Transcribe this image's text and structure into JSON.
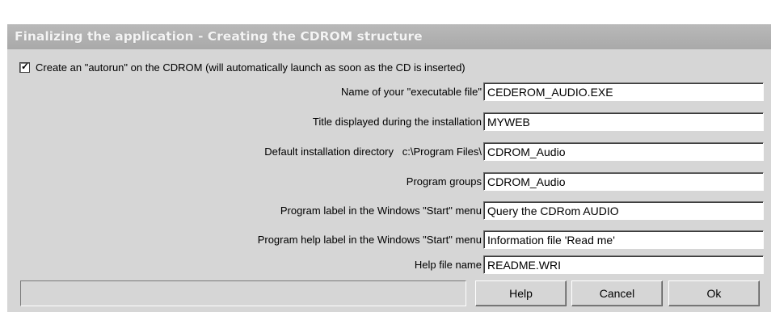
{
  "window": {
    "title": "Finalizing the application - Creating the CDROM structure"
  },
  "autorun": {
    "checked": true,
    "check_mark": "✓",
    "label": "Create an \"autorun\" on the CDROM (will automatically launch as soon as the CD is inserted)"
  },
  "fields": [
    {
      "label": "Name of your \"executable file\"",
      "value": "CEDEROM_AUDIO.EXE"
    },
    {
      "label": "Title displayed during the installation",
      "value": "MYWEB"
    },
    {
      "label": "Default installation directory",
      "prefix": "c:\\Program Files\\",
      "value": "CDROM_Audio"
    },
    {
      "label": "Program groups",
      "value": "CDROM_Audio"
    },
    {
      "label": "Program label in the Windows \"Start\" menu",
      "value": "Query the CDRom AUDIO"
    },
    {
      "label": "Program help label in the Windows \"Start\" menu",
      "value": "Information file 'Read me'"
    },
    {
      "label": "Help file name",
      "value": "README.WRI"
    }
  ],
  "buttons": {
    "help": "Help",
    "cancel": "Cancel",
    "ok": "Ok"
  },
  "status": {
    "text": ""
  }
}
